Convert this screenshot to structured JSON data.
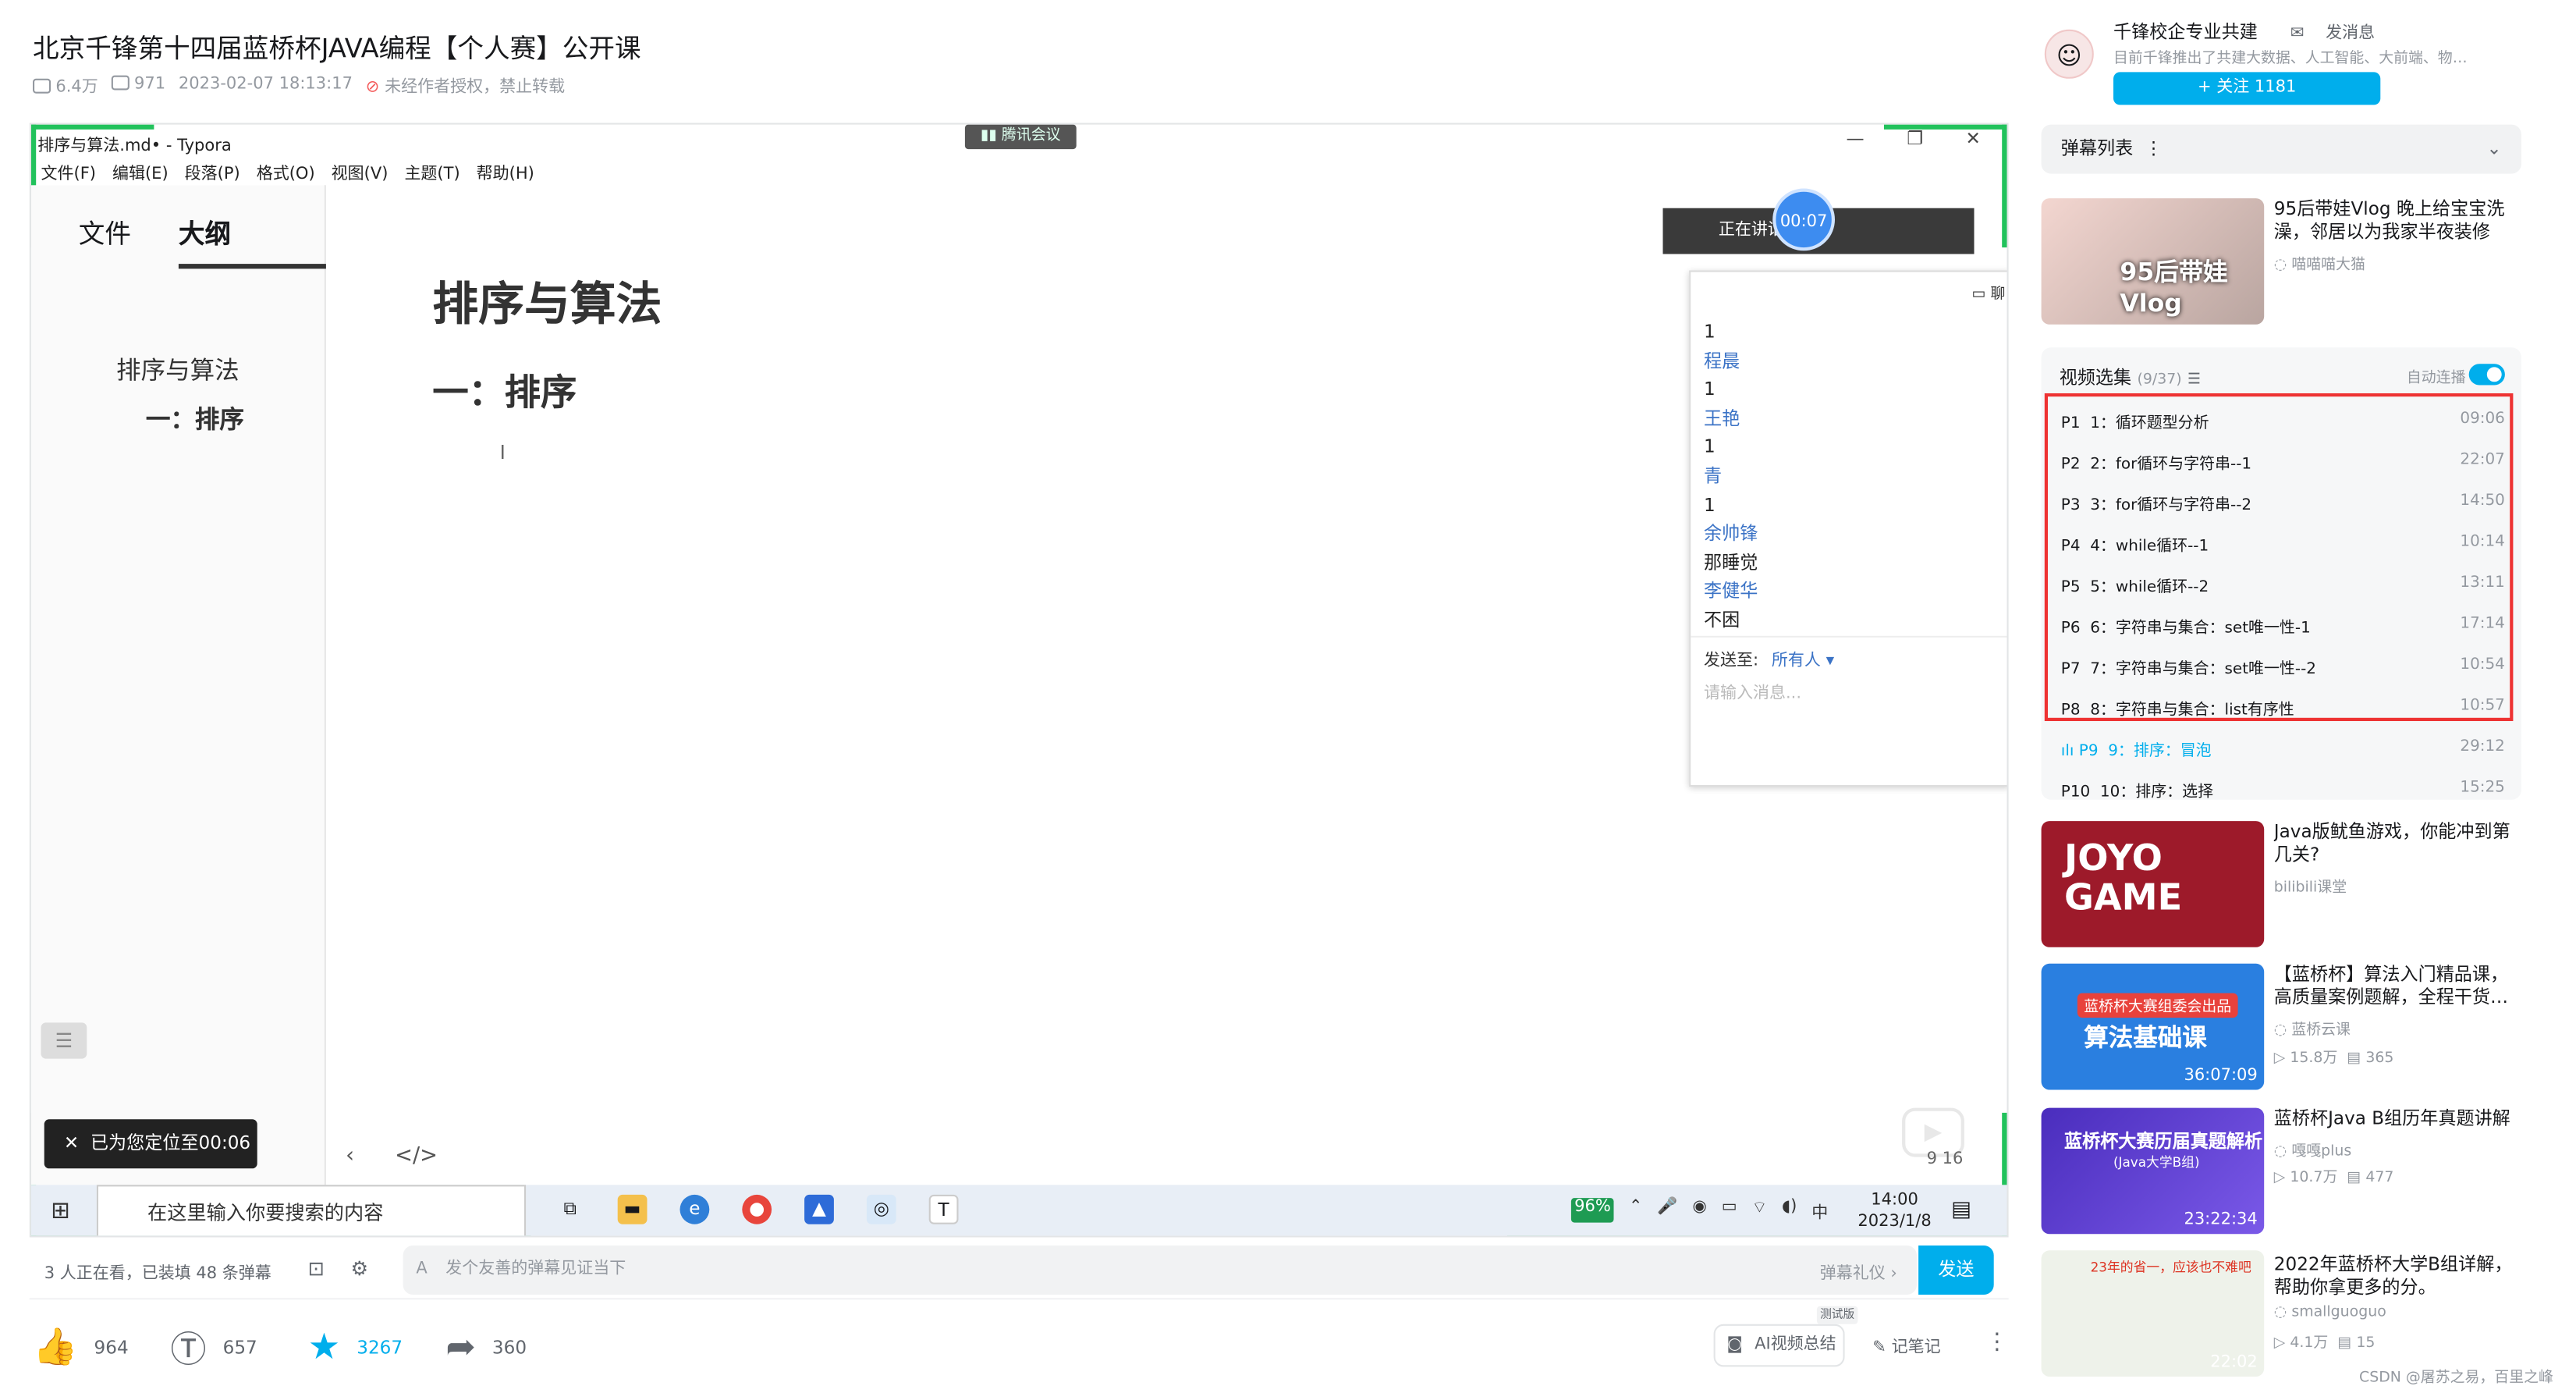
{
  "video": {
    "title": "北京千锋第十四届蓝桥杯JAVA编程【个人赛】公开课",
    "views": "6.4万",
    "danmaku_count": "971",
    "date": "2023-02-07 18:13:17",
    "copyright": "未经作者授权，禁止转载"
  },
  "typora": {
    "window_title": "排序与算法.md• - Typora",
    "menus": [
      "文件(F)",
      "编辑(E)",
      "段落(P)",
      "格式(O)",
      "视图(V)",
      "主题(T)",
      "帮助(H)"
    ],
    "tab_files": "文件",
    "tab_outline": "大纲",
    "outline_1": "排序与算法",
    "outline_2": "一：排序",
    "h1": "排序与算法",
    "h2": "一：排序",
    "page": "9 16"
  },
  "meeting": {
    "app": "腾讯会议",
    "speaking": "正在讲话:",
    "timer": "00:07",
    "chat_top": "聊",
    "chat_items": [
      "1",
      "程晨",
      "1",
      "王艳",
      "1",
      "青",
      "1",
      "余帅锋",
      "那睡觉",
      "李健华",
      "不困"
    ],
    "send_to_label": "发送至:",
    "send_to_value": "所有人 ▾",
    "input_placeholder": "请输入消息..."
  },
  "toast": "已为您定位至00:06",
  "taskbar": {
    "search_placeholder": "在这里输入你要搜索的内容",
    "battery": "96%",
    "ime": "中",
    "time": "14:00",
    "date": "2023/1/8"
  },
  "danmaku_bar": {
    "watching": "3 人正在看，已装填 48 条弹幕",
    "placeholder": "发个友善的弹幕见证当下",
    "etiquette": "弹幕礼仪 ›",
    "send": "发送"
  },
  "actions": {
    "like": "964",
    "coin": "657",
    "fav": "3267",
    "share": "360",
    "ai_summary": "AI视频总结",
    "ai_tag": "测试版",
    "note": "记笔记"
  },
  "uploader": {
    "name": "千锋校企专业共建",
    "message": "发消息",
    "desc": "目前千锋推出了共建大数据、人工智能、大前端、物…",
    "follow": "+ 关注 1181"
  },
  "danmaku_list": {
    "label": "弹幕列表",
    "more": "⋮"
  },
  "rec1": {
    "title": "95后带娃Vlog 晚上给宝宝洗澡，邻居以为我家半夜装修",
    "author": "喵喵喵大猫",
    "thumb_text": "95后带娃 Vlog"
  },
  "playlist": {
    "header": "视频选集",
    "count": "(9/37)",
    "autoplay": "自动连播",
    "items": [
      {
        "p": "P1",
        "t": "1：循环题型分析",
        "d": "09:06"
      },
      {
        "p": "P2",
        "t": "2：for循环与字符串--1",
        "d": "22:07"
      },
      {
        "p": "P3",
        "t": "3：for循环与字符串--2",
        "d": "14:50"
      },
      {
        "p": "P4",
        "t": "4：while循环--1",
        "d": "10:14"
      },
      {
        "p": "P5",
        "t": "5：while循环--2",
        "d": "13:11"
      },
      {
        "p": "P6",
        "t": "6：字符串与集合：set唯一性-1",
        "d": "17:14"
      },
      {
        "p": "P7",
        "t": "7：字符串与集合：set唯一性--2",
        "d": "10:54"
      },
      {
        "p": "P8",
        "t": "8：字符串与集合：list有序性",
        "d": "10:57"
      },
      {
        "p": "P9",
        "t": "9：排序：冒泡",
        "d": "29:12"
      },
      {
        "p": "P10",
        "t": "10：排序：选择",
        "d": "15:25"
      }
    ]
  },
  "rec2": {
    "title": "Java版鱿鱼游戏，你能冲到第几关?",
    "author": "bilibili课堂",
    "thumb_text": "JOYO GAME"
  },
  "rec3": {
    "title": "【蓝桥杯】算法入门精品课，高质量案例题解，全程干货…",
    "author": "蓝桥云课",
    "views": "15.8万",
    "dm": "365",
    "dur": "36:07:09",
    "thumb_top": "蓝桥杯大赛组委会出品",
    "thumb_main": "算法基础课"
  },
  "rec4": {
    "title": "蓝桥杯Java B组历年真题讲解",
    "author": "嘎嘎plus",
    "views": "10.7万",
    "dm": "477",
    "dur": "23:22:34",
    "thumb_main": "蓝桥杯大赛历届真题解析",
    "thumb_sub": "(Java大学B组)"
  },
  "rec5": {
    "title": "2022年蓝桥杯大学B组详解，帮助你拿更多的分。",
    "author": "smallguoguo",
    "views": "4.1万",
    "dm": "15",
    "dur": "22:02",
    "thumb_main": "23年的省一，应该也不难吧"
  },
  "watermark": "CSDN @屠苏之易，百里之峰"
}
